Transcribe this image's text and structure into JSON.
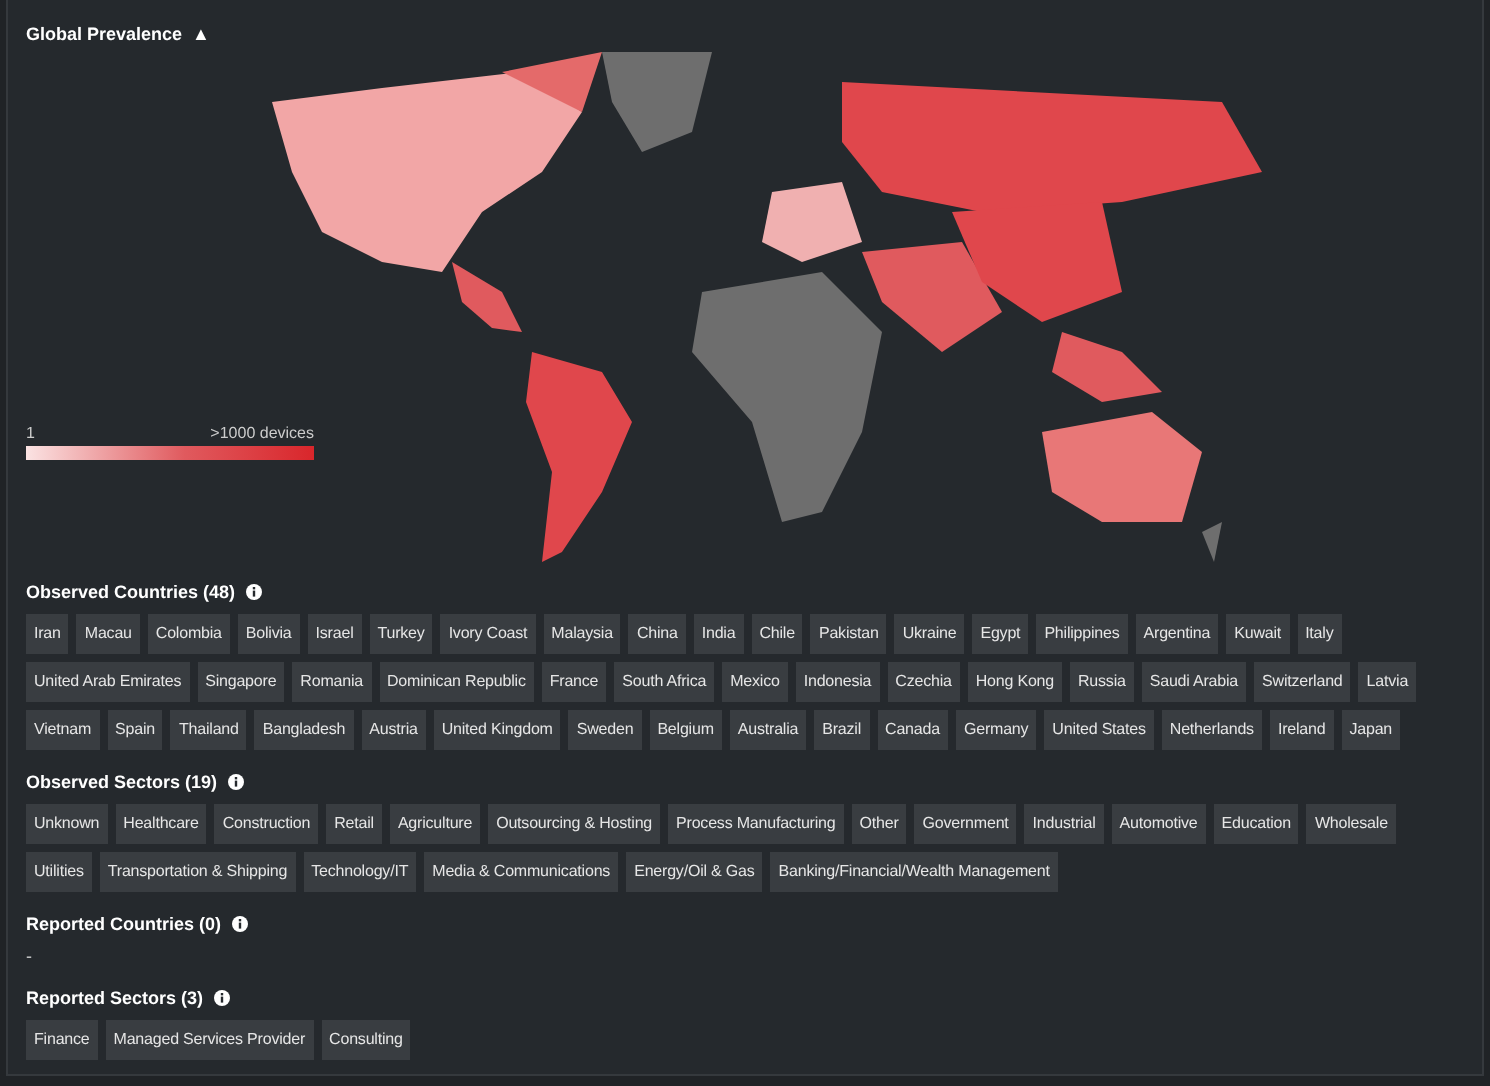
{
  "header": {
    "title": "Global Prevalence",
    "toggle_icon": "▲"
  },
  "map": {
    "legend": {
      "min_label": "1",
      "max_label": ">1000 devices"
    }
  },
  "sections": [
    {
      "title": "Observed Countries (48)",
      "tags": [
        "Iran",
        "Macau",
        "Colombia",
        "Bolivia",
        "Israel",
        "Turkey",
        "Ivory Coast",
        "Malaysia",
        "China",
        "India",
        "Chile",
        "Pakistan",
        "Ukraine",
        "Egypt",
        "Philippines",
        "Argentina",
        "Kuwait",
        "Italy",
        "United Arab Emirates",
        "Singapore",
        "Romania",
        "Dominican Republic",
        "France",
        "South Africa",
        "Mexico",
        "Indonesia",
        "Czechia",
        "Hong Kong",
        "Russia",
        "Saudi Arabia",
        "Switzerland",
        "Latvia",
        "Vietnam",
        "Spain",
        "Thailand",
        "Bangladesh",
        "Austria",
        "United Kingdom",
        "Sweden",
        "Belgium",
        "Australia",
        "Brazil",
        "Canada",
        "Germany",
        "United States",
        "Netherlands",
        "Ireland",
        "Japan"
      ]
    },
    {
      "title": "Observed Sectors (19)",
      "tags": [
        "Unknown",
        "Healthcare",
        "Construction",
        "Retail",
        "Agriculture",
        "Outsourcing & Hosting",
        "Process Manufacturing",
        "Other",
        "Government",
        "Industrial",
        "Automotive",
        "Education",
        "Wholesale",
        "Utilities",
        "Transportation & Shipping",
        "Technology/IT",
        "Media & Communications",
        "Energy/Oil & Gas",
        "Banking/Financial/Wealth Management"
      ]
    },
    {
      "title": "Reported Countries (0)",
      "empty_text": "-"
    },
    {
      "title": "Reported Sectors (3)",
      "tags": [
        "Finance",
        "Managed Services Provider",
        "Consulting"
      ]
    }
  ]
}
